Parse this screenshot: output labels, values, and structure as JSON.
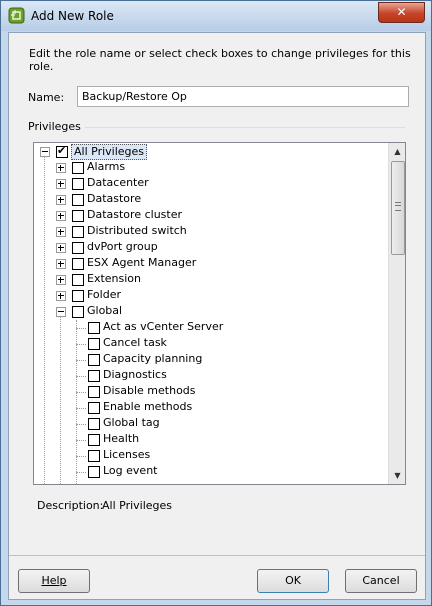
{
  "window": {
    "title": "Add New Role",
    "close_glyph": "✕"
  },
  "instructions": "Edit the role name or select check boxes to change privileges for this role.",
  "name_label": "Name:",
  "name_value": "Backup/Restore Op",
  "privileges_label": "Privileges",
  "tree": {
    "root": {
      "label": "All Privileges",
      "checked": true,
      "expanded": true
    },
    "top_items": [
      {
        "label": "Alarms"
      },
      {
        "label": "Datacenter"
      },
      {
        "label": "Datastore"
      },
      {
        "label": "Datastore cluster"
      },
      {
        "label": "Distributed switch"
      },
      {
        "label": "dvPort group"
      },
      {
        "label": "ESX Agent Manager"
      },
      {
        "label": "Extension"
      },
      {
        "label": "Folder"
      },
      {
        "label": "Global"
      }
    ],
    "global_children": [
      {
        "label": "Act as vCenter Server"
      },
      {
        "label": "Cancel task"
      },
      {
        "label": "Capacity planning"
      },
      {
        "label": "Diagnostics"
      },
      {
        "label": "Disable methods"
      },
      {
        "label": "Enable methods"
      },
      {
        "label": "Global tag"
      },
      {
        "label": "Health"
      },
      {
        "label": "Licenses"
      },
      {
        "label": "Log event"
      }
    ]
  },
  "description_label": "Description:",
  "description_value": "All Privileges",
  "buttons": {
    "help": "Help",
    "ok": "OK",
    "cancel": "Cancel"
  }
}
